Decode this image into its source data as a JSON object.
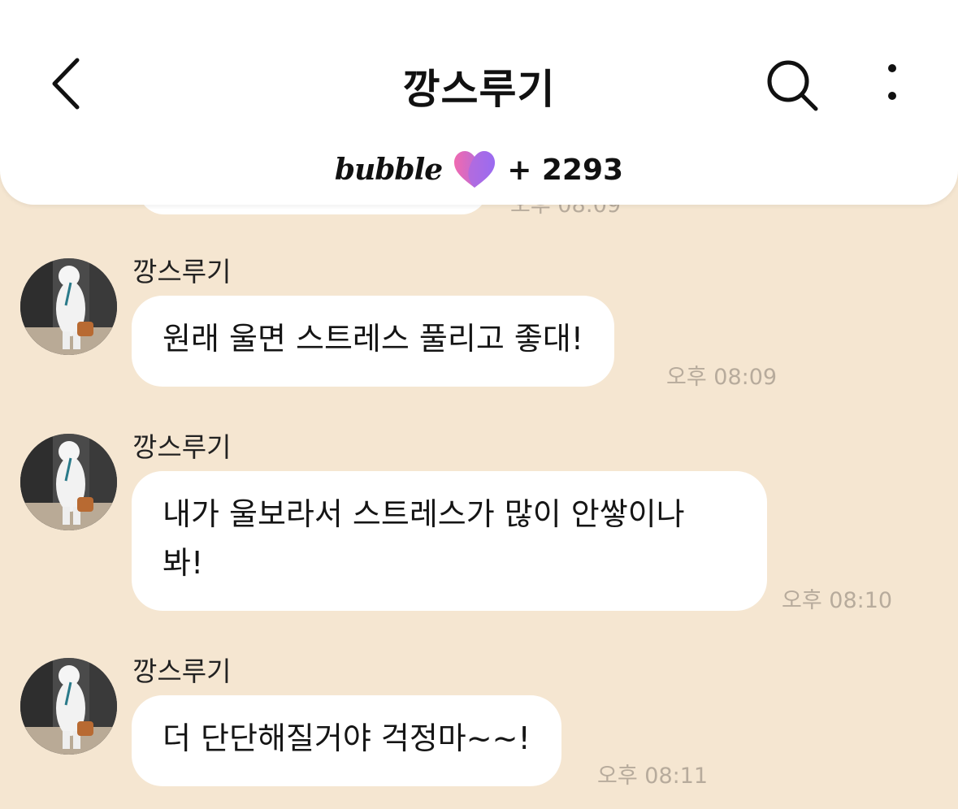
{
  "header": {
    "title": "깡스루기",
    "bubble_logo": "bubble",
    "bubble_count": "+ 2293",
    "icons": [
      "chevron-left-icon",
      "search-icon",
      "more-vertical-icon",
      "heart-icon"
    ]
  },
  "previous_message": {
    "time": "오후 08:09"
  },
  "messages": [
    {
      "sender": "깡스루기",
      "text": "원래 울면 스트레스 풀리고 좋대!",
      "time": "오후 08:09"
    },
    {
      "sender": "깡스루기",
      "text_line1": "내가 울보라서 스트레스가 많이 안쌓이나",
      "text_line2": "봐!",
      "time": "오후 08:10"
    },
    {
      "sender": "깡스루기",
      "text": "더 단단해질거야 걱정마~~!",
      "time": "오후 08:11"
    }
  ],
  "colors": {
    "background": "#f5e6d1",
    "bubble": "#ffffff",
    "timestamp": "#b7ab9c",
    "heart_pink": "#f06ab0",
    "heart_purple": "#9a6cf0"
  }
}
